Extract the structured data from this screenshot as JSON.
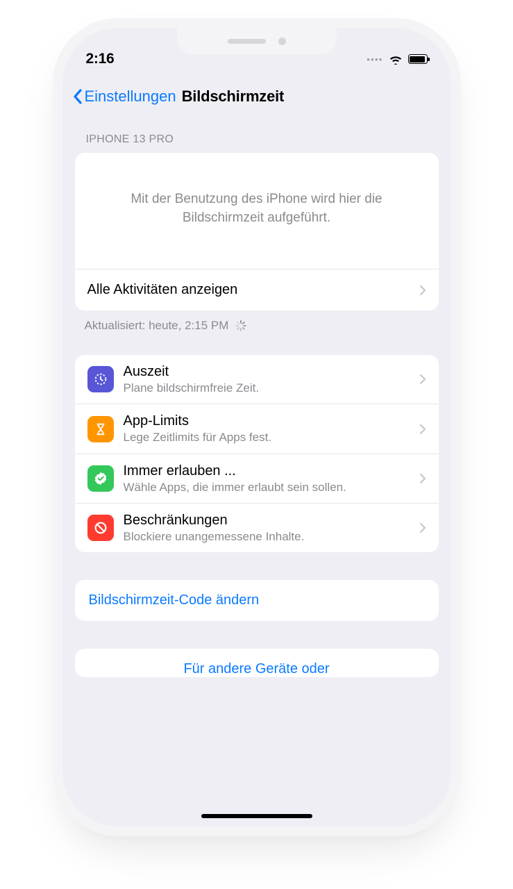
{
  "status": {
    "time": "2:16"
  },
  "nav": {
    "back_label": "Einstellungen",
    "title": "Bildschirmzeit"
  },
  "section1": {
    "header": "IPHONE 13 PRO",
    "placeholder": "Mit der Benutzung des iPhone wird hier die Bildschirmzeit aufgeführt.",
    "all_activities": "Alle Aktivitäten anzeigen",
    "updated": "Aktualisiert: heute, 2:15 PM"
  },
  "options": [
    {
      "title": "Auszeit",
      "sub": "Plane bildschirmfreie Zeit."
    },
    {
      "title": "App-Limits",
      "sub": "Lege Zeitlimits für Apps fest."
    },
    {
      "title": "Immer erlauben ...",
      "sub": "Wähle Apps, die immer erlaubt sein sollen."
    },
    {
      "title": "Beschränkungen",
      "sub": "Blockiere unangemessene Inhalte."
    }
  ],
  "change_code": "Bildschirmzeit-Code ändern",
  "cutoff": "Für andere Geräte oder"
}
